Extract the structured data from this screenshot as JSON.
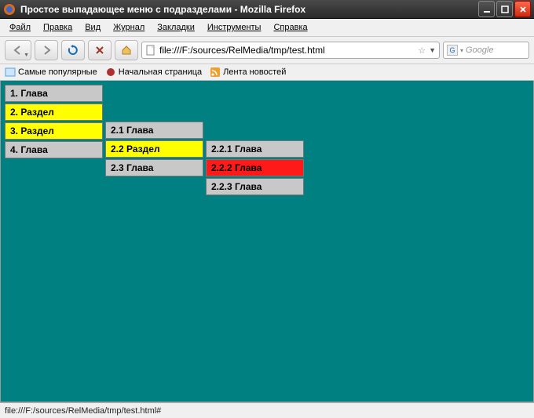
{
  "window": {
    "title": "Простое выпадающее меню с подразделами - Mozilla Firefox"
  },
  "menubar": {
    "file": "Файл",
    "edit": "Правка",
    "view": "Вид",
    "history": "Журнал",
    "bookmarks": "Закладки",
    "tools": "Инструменты",
    "help": "Справка"
  },
  "toolbar": {
    "url": "file:///F:/sources/RelMedia/tmp/test.html",
    "search_placeholder": "Google"
  },
  "bookmarks": {
    "popular": "Самые популярные",
    "startpage": "Начальная страница",
    "news": "Лента новостей"
  },
  "dropdown": {
    "level0": [
      {
        "label": "1. Глава",
        "hl": false
      },
      {
        "label": "2. Раздел",
        "hl": true
      },
      {
        "label": "3. Раздел",
        "hl": true
      },
      {
        "label": "4. Глава",
        "hl": false
      }
    ],
    "level1": [
      {
        "label": "2.1 Глава",
        "hl": false
      },
      {
        "label": "2.2 Раздел",
        "hl": true
      },
      {
        "label": "2.3 Глава",
        "hl": false
      }
    ],
    "level2": [
      {
        "label": "2.2.1 Глава",
        "cls": ""
      },
      {
        "label": "2.2.2 Глава",
        "cls": "red"
      },
      {
        "label": "2.2.3 Глава",
        "cls": ""
      }
    ]
  },
  "statusbar": {
    "text": "file:///F:/sources/RelMedia/tmp/test.html#"
  }
}
